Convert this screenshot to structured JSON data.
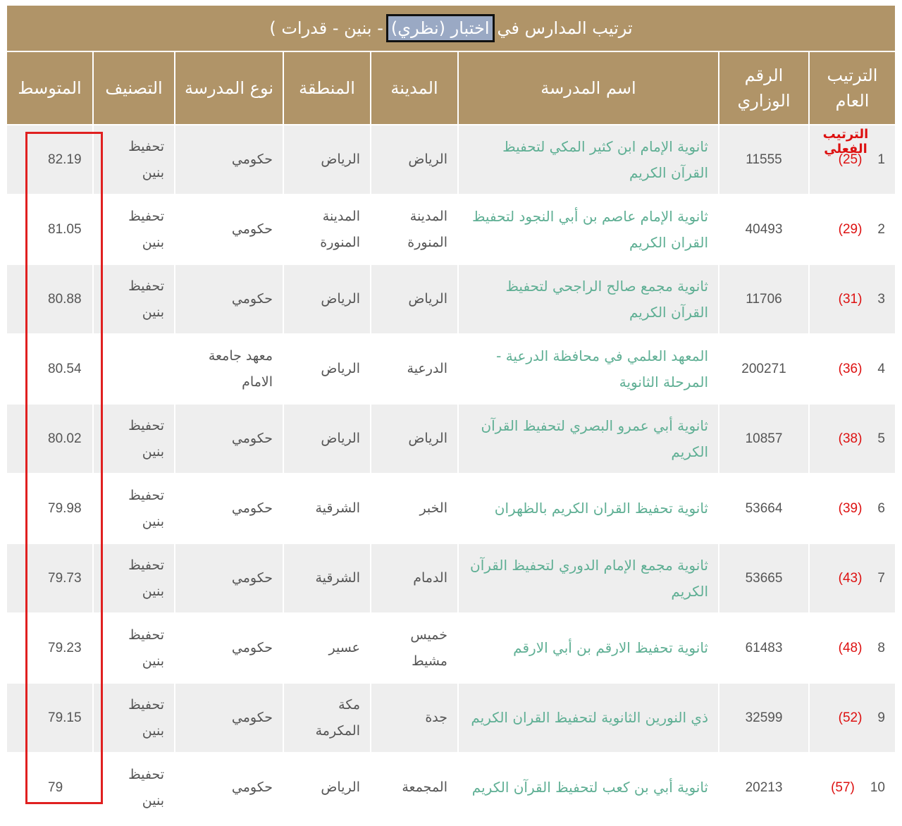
{
  "title": {
    "before": "ترتيب المدارس في",
    "highlight": "اختبار (نظري)",
    "after": "- بنين - قدرات )"
  },
  "actual_rank_label": "الترتيب الفعلي",
  "headers": {
    "rank": "الترتيب العام",
    "ministry_no": "الرقم الوزاري",
    "school": "اسم المدرسة",
    "city": "المدينة",
    "region": "المنطقة",
    "type": "نوع المدرسة",
    "category": "التصنيف",
    "average": "المتوسط"
  },
  "rows": [
    {
      "rank": "1",
      "actual": "(25)",
      "ministry_no": "11555",
      "school": "ثانوية الإمام ابن كثير المكي لتحفيظ القرآن الكريم",
      "city": "الرياض",
      "region": "الرياض",
      "type": "حكومي",
      "category": "تحفيظ بنين",
      "average": "82.19"
    },
    {
      "rank": "2",
      "actual": "(29)",
      "ministry_no": "40493",
      "school": "ثانوية الإمام عاصم بن أبي النجود لتحفيظ القران الكريم",
      "city": "المدينة المنورة",
      "region": "المدينة المنورة",
      "type": "حكومي",
      "category": "تحفيظ بنين",
      "average": "81.05"
    },
    {
      "rank": "3",
      "actual": "(31)",
      "ministry_no": "11706",
      "school": "ثانوية مجمع صالح الراجحي لتحفيظ القرآن الكريم",
      "city": "الرياض",
      "region": "الرياض",
      "type": "حكومي",
      "category": "تحفيظ بنين",
      "average": "80.88"
    },
    {
      "rank": "4",
      "actual": "(36)",
      "ministry_no": "200271",
      "school": "المعهد العلمي في محافظة الدرعية - المرحلة الثانوية",
      "city": "الدرعية",
      "region": "الرياض",
      "type": "معهد جامعة الامام",
      "category": "",
      "average": "80.54"
    },
    {
      "rank": "5",
      "actual": "(38)",
      "ministry_no": "10857",
      "school": "ثانوية أبي عمرو البصري لتحفيظ القرآن الكريم",
      "city": "الرياض",
      "region": "الرياض",
      "type": "حكومي",
      "category": "تحفيظ بنين",
      "average": "80.02"
    },
    {
      "rank": "6",
      "actual": "(39)",
      "ministry_no": "53664",
      "school": "ثانوية تحفيظ القران الكريم بالظهران",
      "city": "الخبر",
      "region": "الشرقية",
      "type": "حكومي",
      "category": "تحفيظ بنين",
      "average": "79.98"
    },
    {
      "rank": "7",
      "actual": "(43)",
      "ministry_no": "53665",
      "school": "ثانوية مجمع الإمام الدوري لتحفيظ القرآن الكريم",
      "city": "الدمام",
      "region": "الشرقية",
      "type": "حكومي",
      "category": "تحفيظ بنين",
      "average": "79.73"
    },
    {
      "rank": "8",
      "actual": "(48)",
      "ministry_no": "61483",
      "school": "ثانوية تحفيظ الارقم بن أبي الارقم",
      "city": "خميس مشيط",
      "region": "عسير",
      "type": "حكومي",
      "category": "تحفيظ بنين",
      "average": "79.23"
    },
    {
      "rank": "9",
      "actual": "(52)",
      "ministry_no": "32599",
      "school": "ذي النورين الثانوية لتحفيظ القران الكريم",
      "city": "جدة",
      "region": "مكة المكرمة",
      "type": "حكومي",
      "category": "تحفيظ بنين",
      "average": "79.15"
    },
    {
      "rank": "10",
      "actual": "(57)",
      "ministry_no": "20213",
      "school": "ثانوية أبي بن كعب لتحفيظ القرآن الكريم",
      "city": "المجمعة",
      "region": "الرياض",
      "type": "حكومي",
      "category": "تحفيظ بنين",
      "average": "79"
    }
  ]
}
